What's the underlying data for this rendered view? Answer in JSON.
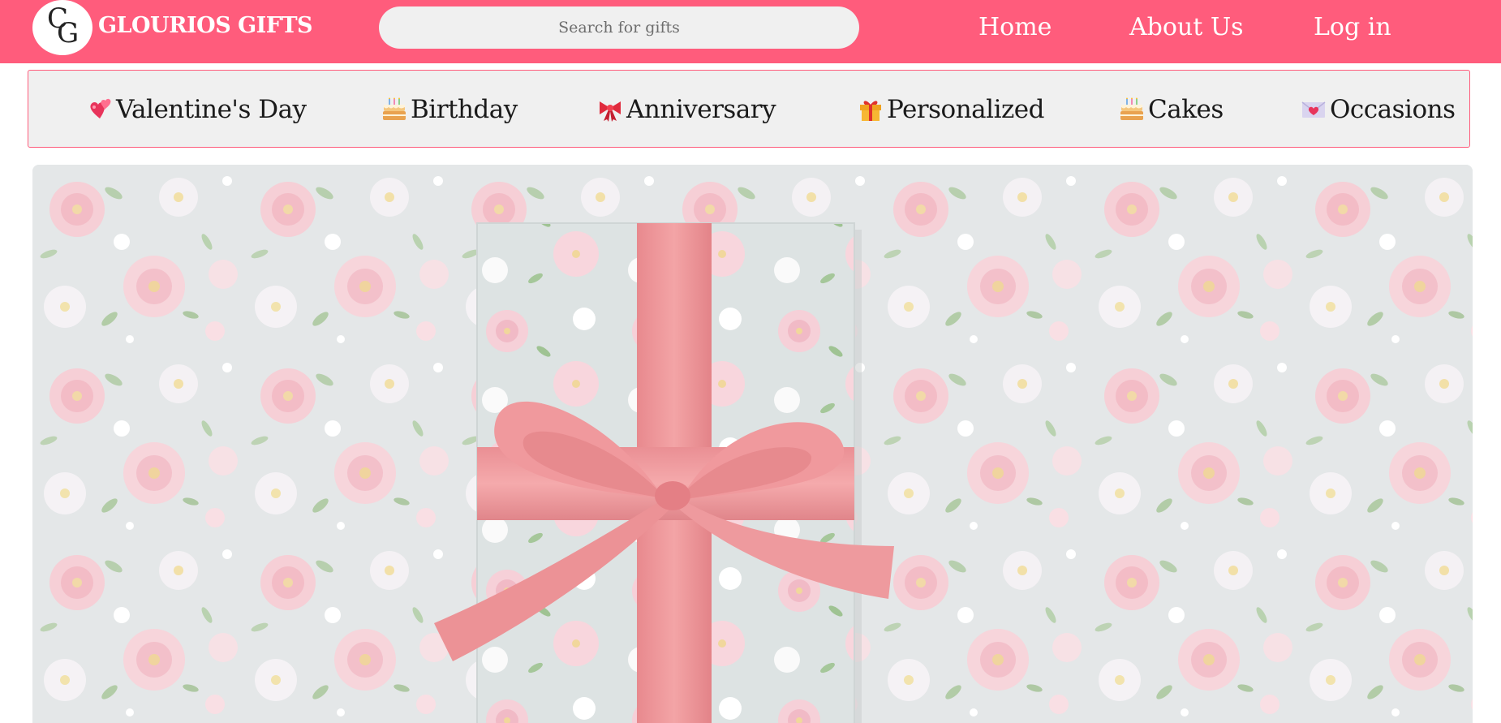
{
  "header": {
    "logo_letters": [
      "C",
      "G"
    ],
    "brand_name": "GLOURIOS GIFTS",
    "search_placeholder": "Search for gifts",
    "nav": {
      "home": "Home",
      "about": "About Us",
      "login": "Log in"
    }
  },
  "categories": [
    {
      "label": "Valentine's Day",
      "icon": "heart-icon"
    },
    {
      "label": "Birthday",
      "icon": "cake-icon"
    },
    {
      "label": "Anniversary",
      "icon": "ribbon-bow-icon"
    },
    {
      "label": "Personalized",
      "icon": "gift-icon"
    },
    {
      "label": "Cakes",
      "icon": "cake-icon"
    },
    {
      "label": "Occasions",
      "icon": "love-letter-icon"
    }
  ],
  "colors": {
    "header_bg": "#ff5c7c",
    "category_bar_bg": "#f0f0f0",
    "category_bar_border": "#ff5c7c",
    "ribbon": "#ef9c9c"
  }
}
